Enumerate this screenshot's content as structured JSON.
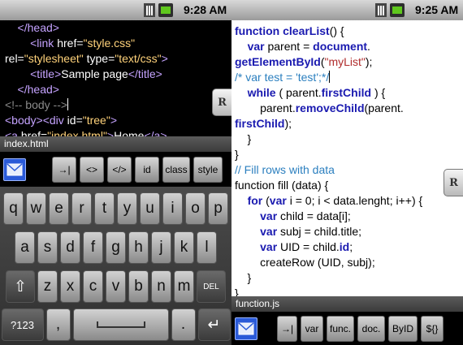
{
  "left_panel": {
    "status": {
      "time": "9:28 AM"
    },
    "code_lines": [
      [
        {
          "c": "d-tag",
          "t": "    </head>"
        }
      ],
      [
        {
          "c": "d-tag",
          "t": "        <link "
        },
        {
          "c": "d-attr",
          "t": "href="
        },
        {
          "c": "d-str",
          "t": "\"style.css\""
        }
      ],
      [
        {
          "c": "d-attr",
          "t": "rel="
        },
        {
          "c": "d-str",
          "t": "\"stylesheet\""
        },
        {
          "c": "d-attr",
          "t": " type="
        },
        {
          "c": "d-str",
          "t": "\"text/css\""
        },
        {
          "c": "d-tag",
          "t": ">"
        }
      ],
      [
        {
          "c": "d-tag",
          "t": "        <title>"
        },
        {
          "c": "d-tx",
          "t": "Sample page"
        },
        {
          "c": "d-tag",
          "t": "</title>"
        }
      ],
      [
        {
          "c": "d-tag",
          "t": "    </head>"
        }
      ],
      [
        {
          "c": "d-cm",
          "t": "<!-- body -->"
        },
        {
          "c": "cur",
          "t": ""
        }
      ],
      [
        {
          "c": "d-tag",
          "t": "<body><div "
        },
        {
          "c": "d-attr",
          "t": "id="
        },
        {
          "c": "d-str",
          "t": "\"tree\""
        },
        {
          "c": "d-tag",
          "t": ">"
        }
      ],
      [
        {
          "c": "d-tag",
          "t": "<a "
        },
        {
          "c": "d-attr",
          "t": "href="
        },
        {
          "c": "d-str",
          "t": "\"index.html\""
        },
        {
          "c": "d-tag",
          "t": ">"
        },
        {
          "c": "d-tx",
          "t": "Home"
        },
        {
          "c": "d-tag",
          "t": "</a>"
        }
      ]
    ],
    "filename": "index.html",
    "tag_buttons": [
      "→|",
      "<>",
      "</>",
      "id",
      "class",
      "style"
    ],
    "keyboard": {
      "row1": [
        "q",
        "w",
        "e",
        "r",
        "t",
        "y",
        "u",
        "i",
        "o",
        "p"
      ],
      "row2": [
        "a",
        "s",
        "d",
        "f",
        "g",
        "h",
        "j",
        "k",
        "l"
      ],
      "row3": [
        "z",
        "x",
        "c",
        "v",
        "b",
        "n",
        "m"
      ],
      "shift_label": "⇧",
      "del_label": "DEL",
      "numsym_label": "?123",
      "comma": ",",
      "period": ".",
      "enter_label": "↵"
    },
    "rtab_label": "R"
  },
  "right_panel": {
    "status": {
      "time": "9:25 AM"
    },
    "code_lines": [
      [
        {
          "c": "l-kw",
          "t": "function "
        },
        {
          "c": "l-fn",
          "t": "clearList"
        },
        {
          "c": "l-tx",
          "t": "() {"
        }
      ],
      [
        {
          "c": "l-tx",
          "t": "    "
        },
        {
          "c": "l-kw",
          "t": "var "
        },
        {
          "c": "l-tx",
          "t": "parent = "
        },
        {
          "c": "l-kw",
          "t": "document"
        },
        {
          "c": "l-tx",
          "t": "."
        }
      ],
      [
        {
          "c": "l-fn",
          "t": "getElementById"
        },
        {
          "c": "l-tx",
          "t": "("
        },
        {
          "c": "l-str",
          "t": "\"myList\""
        },
        {
          "c": "l-tx",
          "t": ");"
        }
      ],
      [
        {
          "c": "l-cm",
          "t": "/* var test = 'test';*/"
        },
        {
          "c": "cur-d",
          "t": ""
        }
      ],
      [
        {
          "c": "l-tx",
          "t": "    "
        },
        {
          "c": "l-kw",
          "t": "while "
        },
        {
          "c": "l-tx",
          "t": "( parent."
        },
        {
          "c": "l-fn",
          "t": "firstChild"
        },
        {
          "c": "l-tx",
          "t": " ) {"
        }
      ],
      [
        {
          "c": "l-tx",
          "t": "        parent."
        },
        {
          "c": "l-fn",
          "t": "removeChild"
        },
        {
          "c": "l-tx",
          "t": "(parent."
        }
      ],
      [
        {
          "c": "l-fn",
          "t": "firstChild"
        },
        {
          "c": "l-tx",
          "t": ");"
        }
      ],
      [
        {
          "c": "l-tx",
          "t": "    }"
        }
      ],
      [
        {
          "c": "l-tx",
          "t": "}"
        }
      ],
      [
        {
          "c": "l-tx",
          "t": ""
        }
      ],
      [
        {
          "c": "l-cm",
          "t": "// Fill rows with data"
        }
      ],
      [
        {
          "c": "l-tx",
          "t": "function fill (data) {"
        }
      ],
      [
        {
          "c": "l-tx",
          "t": "    "
        },
        {
          "c": "l-kw",
          "t": "for "
        },
        {
          "c": "l-tx",
          "t": "("
        },
        {
          "c": "l-kw",
          "t": "var "
        },
        {
          "c": "l-tx",
          "t": "i = 0; i < data.lenght; i++) {"
        }
      ],
      [
        {
          "c": "l-tx",
          "t": "        "
        },
        {
          "c": "l-kw",
          "t": "var "
        },
        {
          "c": "l-tx",
          "t": "child = data[i];"
        }
      ],
      [
        {
          "c": "l-tx",
          "t": "        "
        },
        {
          "c": "l-kw",
          "t": "var "
        },
        {
          "c": "l-tx",
          "t": "subj = child.title;"
        }
      ],
      [
        {
          "c": "l-tx",
          "t": "        "
        },
        {
          "c": "l-kw",
          "t": "var "
        },
        {
          "c": "l-tx",
          "t": "UID = child."
        },
        {
          "c": "l-kw",
          "t": "id"
        },
        {
          "c": "l-tx",
          "t": ";"
        }
      ],
      [
        {
          "c": "l-tx",
          "t": "        createRow (UID, subj);"
        }
      ],
      [
        {
          "c": "l-tx",
          "t": "    }"
        }
      ],
      [
        {
          "c": "l-tx",
          "t": "}"
        }
      ]
    ],
    "filename": "function.js",
    "tag_buttons": [
      "→|",
      "var",
      "func.",
      "doc.",
      "ByID",
      "${}"
    ],
    "rtab_label": "R"
  }
}
